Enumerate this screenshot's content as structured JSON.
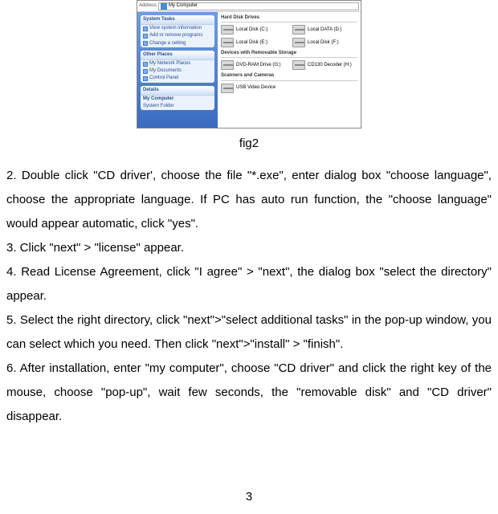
{
  "screenshot": {
    "address_label": "Address",
    "address_value": "My Computer",
    "left_panels": [
      {
        "title": "System Tasks",
        "items": [
          "View system information",
          "Add or remove programs",
          "Change a setting"
        ]
      },
      {
        "title": "Other Places",
        "items": [
          "My Network Places",
          "My Documents",
          "Control Panel"
        ]
      },
      {
        "title": "Details",
        "items": [
          "My Computer",
          "System Folder"
        ]
      }
    ],
    "sections": [
      {
        "header": "Hard Disk Drives",
        "drives": [
          "Local Disk (C:)",
          "Local DATA (D:)",
          "Local Disk (E:)",
          "Local Disk (F:)"
        ]
      },
      {
        "header": "Devices with Removable Storage",
        "drives": [
          "DVD-RAM Drive (G:)",
          "CD130 Decoder (H:)"
        ]
      },
      {
        "header": "Scanners and Cameras",
        "drives": [
          "USB Video Device"
        ]
      }
    ]
  },
  "caption": "fig2",
  "steps": {
    "s2": "2. Double click \"CD driver', choose the file \"*.exe\", enter dialog box \"choose language\", choose the appropriate language. If PC has auto run function, the \"choose language\" would appear automatic, click \"yes\".",
    "s3": "3. Click \"next\" > \"license\" appear.",
    "s4": "4. Read License Agreement, click \"I agree\" > \"next\", the dialog box \"select the directory\" appear.",
    "s5": "5. Select the right directory, click \"next\">\"select additional tasks\" in the pop-up window, you can select which you need. Then click \"next\">\"install\" > \"finish\".",
    "s6": "6. After installation, enter \"my computer\", choose \"CD driver\" and click the right key of the mouse, choose \"pop-up\", wait few seconds, the \"removable disk\" and \"CD driver\" disappear."
  },
  "page_number": "3"
}
